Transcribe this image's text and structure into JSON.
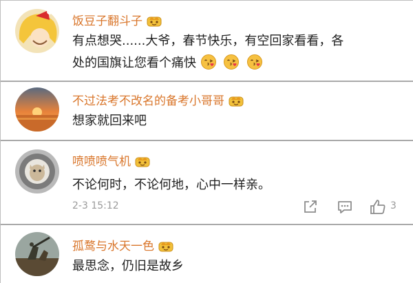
{
  "comments": [
    {
      "username": "饭豆子翻斗子",
      "lines": [
        "有点想哭......大爷，春节快乐，有空回家看看，各",
        "处的国旗让您看个痛快"
      ],
      "emojis": [
        "kissing-face-icon",
        "kissing-face-icon",
        "kissing-face-icon"
      ]
    },
    {
      "username": "不过法考不改名的备考小哥哥",
      "lines": [
        "想家就回来吧"
      ]
    },
    {
      "username": "喷喷喷气机",
      "lines": [
        "不论何时，不论何地，心中一样亲。"
      ],
      "timestamp": "2-3 15:12",
      "likes": "3"
    },
    {
      "username": "孤鹜与水天一色",
      "lines": [
        "最思念，仍旧是故乡"
      ]
    }
  ],
  "colors": {
    "username": "#d9762b",
    "text": "#1f1f1f",
    "meta": "#9a9a9a",
    "separator": "#a9a9a9"
  },
  "icons": {
    "badge": "crown-badge-icon",
    "share": "share-icon",
    "comment": "comment-icon",
    "like": "thumbs-up-icon"
  }
}
